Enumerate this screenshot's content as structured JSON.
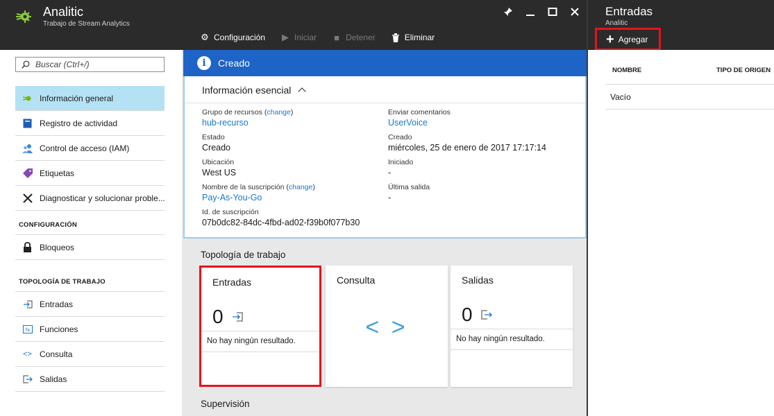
{
  "header": {
    "title": "Analitic",
    "subtitle": "Trabajo de Stream Analytics",
    "toolbar": {
      "config": "Configuración",
      "start": "Iniciar",
      "stop": "Detener",
      "delete": "Eliminar"
    }
  },
  "search": {
    "placeholder": "Buscar (Ctrl+/)"
  },
  "sidebar": {
    "items": [
      {
        "label": "Información general"
      },
      {
        "label": "Registro de actividad"
      },
      {
        "label": "Control de acceso (IAM)"
      },
      {
        "label": "Etiquetas"
      },
      {
        "label": "Diagnosticar y solucionar proble..."
      }
    ],
    "section_config": "CONFIGURACIÓN",
    "config_items": [
      {
        "label": "Bloqueos"
      }
    ],
    "section_topology": "TOPOLOGÍA DE TRABAJO",
    "topology_items": [
      {
        "label": "Entradas"
      },
      {
        "label": "Funciones"
      },
      {
        "label": "Consulta"
      },
      {
        "label": "Salidas"
      }
    ]
  },
  "banner": {
    "text": "Creado"
  },
  "essentials": {
    "title": "Información esencial",
    "resource_group_label": "Grupo de recursos",
    "change": "change",
    "resource_group_value": "hub-recurso",
    "state_label": "Estado",
    "state_value": "Creado",
    "location_label": "Ubicación",
    "location_value": "West US",
    "subscription_label": "Nombre de la suscripción",
    "subscription_value": "Pay-As-You-Go",
    "subscription_id_label": "Id. de suscripción",
    "subscription_id_value": "07b0dc82-84dc-4fbd-ad02-f39b0f077b30",
    "feedback_label": "Enviar comentarios",
    "feedback_value": "UserVoice",
    "created_label": "Creado",
    "created_value": "miércoles, 25 de enero de 2017 17:17:14",
    "started_label": "Iniciado",
    "started_value": "-",
    "last_output_label": "Última salida",
    "last_output_value": "-"
  },
  "topology": {
    "title": "Topología de trabajo",
    "inputs": {
      "title": "Entradas",
      "count": "0",
      "message": "No hay ningún resultado."
    },
    "query": {
      "title": "Consulta",
      "glyph": "< >"
    },
    "outputs": {
      "title": "Salidas",
      "count": "0",
      "message": "No hay ningún resultado."
    }
  },
  "monitoring": {
    "title": "Supervisión"
  },
  "inputs_blade": {
    "title": "Entradas",
    "subtitle": "Analitic",
    "add_label": "Agregar",
    "col_name": "NOMBRE",
    "col_source_type": "TIPO DE ORIGEN",
    "empty": "Vacío"
  },
  "colors": {
    "header_bg": "#2b2b2b",
    "banner_blue": "#1e63c6",
    "link_blue": "#1877cc",
    "highlight_red": "#e3151b",
    "active_nav": "#b4e2f4"
  }
}
